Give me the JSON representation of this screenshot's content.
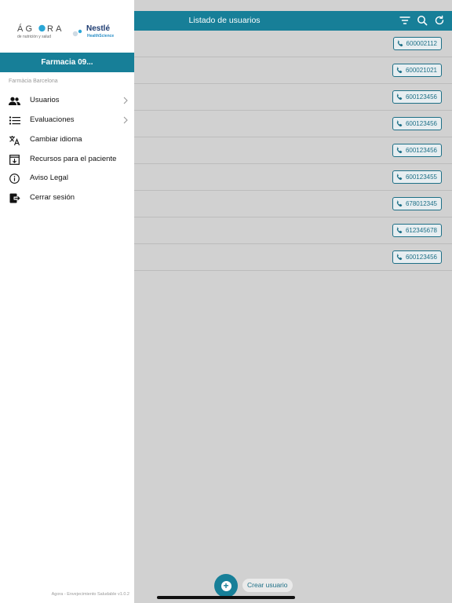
{
  "header": {
    "title": "Listado de usuarios"
  },
  "users": [
    {
      "phone": "600002112"
    },
    {
      "phone": "600021021"
    },
    {
      "phone": "600123456"
    },
    {
      "phone": "600123456"
    },
    {
      "phone": "600123456"
    },
    {
      "phone": "600123455"
    },
    {
      "phone": "678012345"
    },
    {
      "phone": "612345678"
    },
    {
      "phone": "600123456"
    }
  ],
  "fab": {
    "label": "Crear usuario"
  },
  "drawer": {
    "logo": {
      "brand": "ÁGORA",
      "tagline": "de nutrición y salud",
      "partner": "Nestlé",
      "partner_sub": "HealthScience"
    },
    "pharmacy_name": "Farmacia 09...",
    "pharmacy_subtitle": "Farmàcia Barcelona",
    "items": [
      {
        "label": "Usuarios",
        "icon": "users-icon",
        "chevron": true
      },
      {
        "label": "Evaluaciones",
        "icon": "list-icon",
        "chevron": true
      },
      {
        "label": "Cambiar idioma",
        "icon": "translate-icon",
        "chevron": false
      },
      {
        "label": "Recursos para el paciente",
        "icon": "download-box-icon",
        "chevron": false
      },
      {
        "label": "Aviso Legal",
        "icon": "info-icon",
        "chevron": false
      },
      {
        "label": "Cerrar sesión",
        "icon": "logout-icon",
        "chevron": false
      }
    ],
    "version": "Agora - Envejecimiento Saludable v1.0.2"
  },
  "colors": {
    "accent": "#177f98",
    "overlay": "#d1d1d1",
    "phone_text": "#1d6f86"
  }
}
